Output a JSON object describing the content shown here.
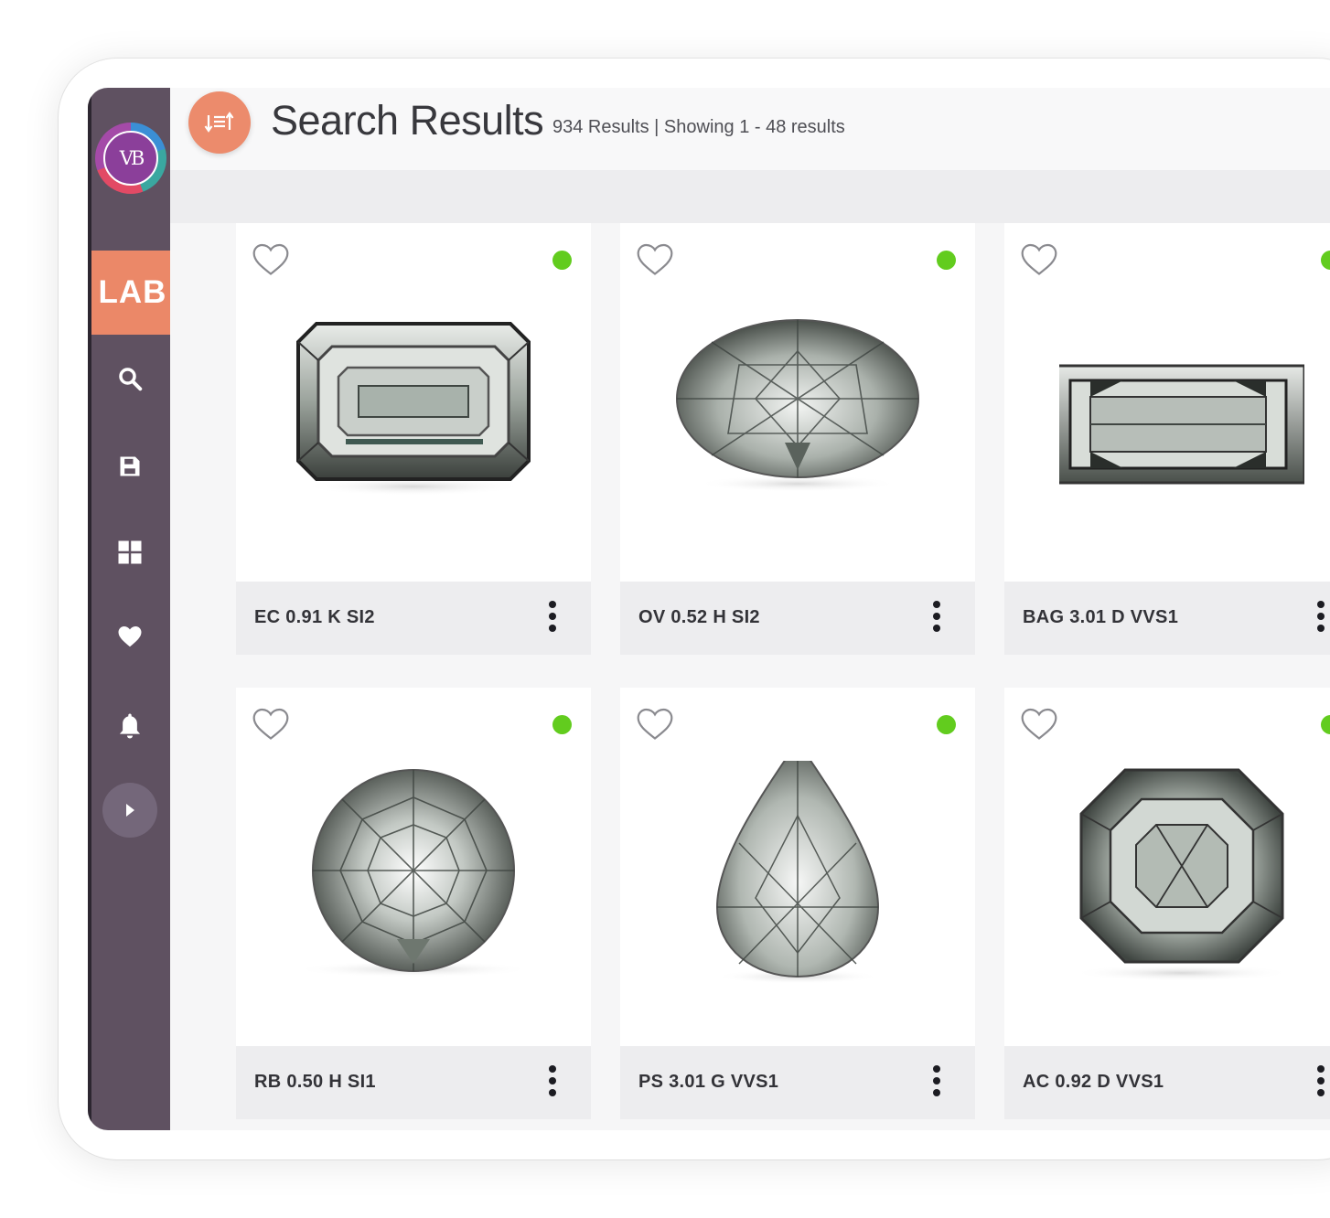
{
  "header": {
    "title": "Search Results",
    "result_summary": "934 Results | Showing 1 - 48 results"
  },
  "sidebar": {
    "logo_text": "VB",
    "lab_label": "LAB",
    "items": [
      {
        "icon": "search-icon"
      },
      {
        "icon": "save-icon"
      },
      {
        "icon": "grid-icon"
      },
      {
        "icon": "heart-icon"
      },
      {
        "icon": "bell-icon"
      },
      {
        "icon": "expand-arrow-icon"
      }
    ]
  },
  "colors": {
    "sidebar": "#5f5161",
    "accent": "#eb8868",
    "available_dot": "#62cc1e"
  },
  "cards": [
    {
      "label": "EC 0.91 K SI2",
      "shape": "emerald",
      "status": "available"
    },
    {
      "label": "OV 0.52 H SI2",
      "shape": "oval",
      "status": "available"
    },
    {
      "label": "BAG 3.01 D VVS1",
      "shape": "baguette",
      "status": "available"
    },
    {
      "label": "RB 0.50 H SI1",
      "shape": "round",
      "status": "available"
    },
    {
      "label": "PS 3.01 G VVS1",
      "shape": "pear",
      "status": "available"
    },
    {
      "label": "AC 0.92 D VVS1",
      "shape": "asscher",
      "status": "available"
    }
  ]
}
